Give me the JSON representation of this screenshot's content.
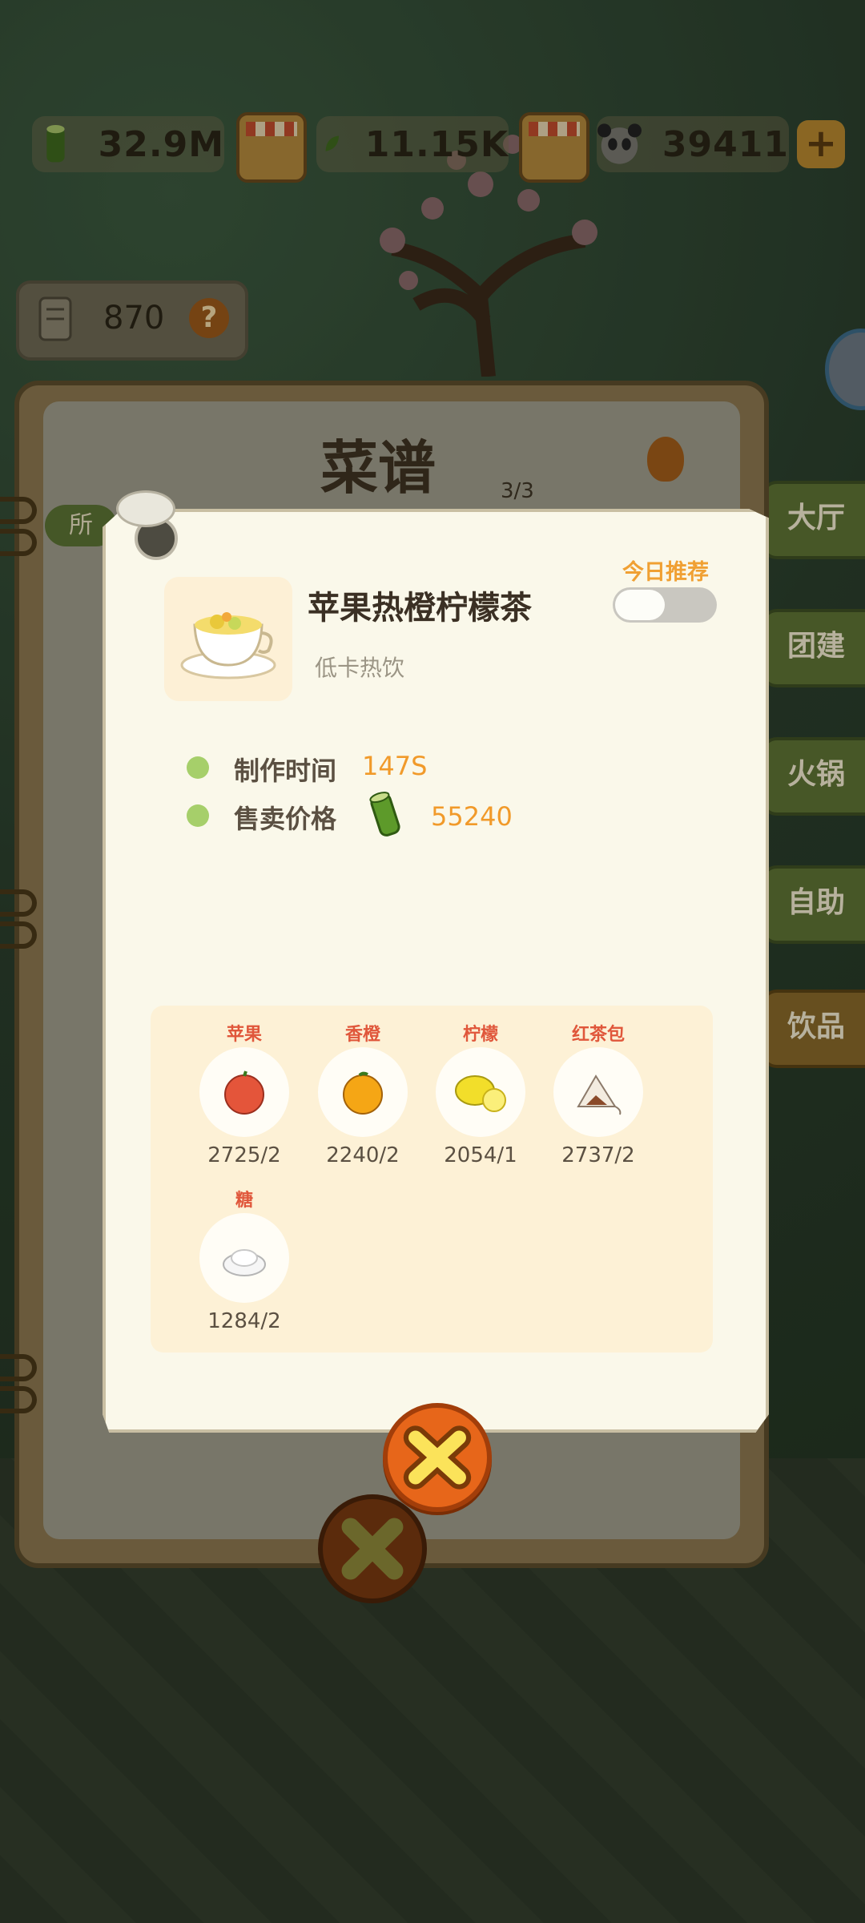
{
  "resources": {
    "bamboo": "32.9M",
    "leaf": "11.15K",
    "panda": "39411"
  },
  "score_chip": {
    "value": "870",
    "help": "?"
  },
  "side_tabs": [
    "大厅",
    "团建",
    "火锅",
    "自助",
    "饮品"
  ],
  "book": {
    "title": "菜谱",
    "page": "3/3",
    "tab_label": "所",
    "help": "?"
  },
  "recipe": {
    "name": "苹果热橙柠檬茶",
    "category": "低卡热饮",
    "today_recommend_label": "今日推荐",
    "today_recommend_on": false,
    "stats": [
      {
        "label": "制作时间",
        "value": "147S"
      },
      {
        "label": "售卖价格",
        "value": "55240",
        "icon": "bamboo-icon"
      }
    ],
    "ingredients": [
      {
        "name": "苹果",
        "count": "2725/2",
        "icon": "apple-icon"
      },
      {
        "name": "香橙",
        "count": "2240/2",
        "icon": "orange-icon"
      },
      {
        "name": "柠檬",
        "count": "2054/1",
        "icon": "lemon-icon"
      },
      {
        "name": "红茶包",
        "count": "2737/2",
        "icon": "tea-bag-icon"
      },
      {
        "name": "糖",
        "count": "1284/2",
        "icon": "sugar-icon"
      }
    ]
  },
  "colors": {
    "accent_orange": "#f19a2a",
    "ingredient_name": "#e0573b",
    "dot_green": "#a6cf6a",
    "close_button": "#e7661a"
  }
}
